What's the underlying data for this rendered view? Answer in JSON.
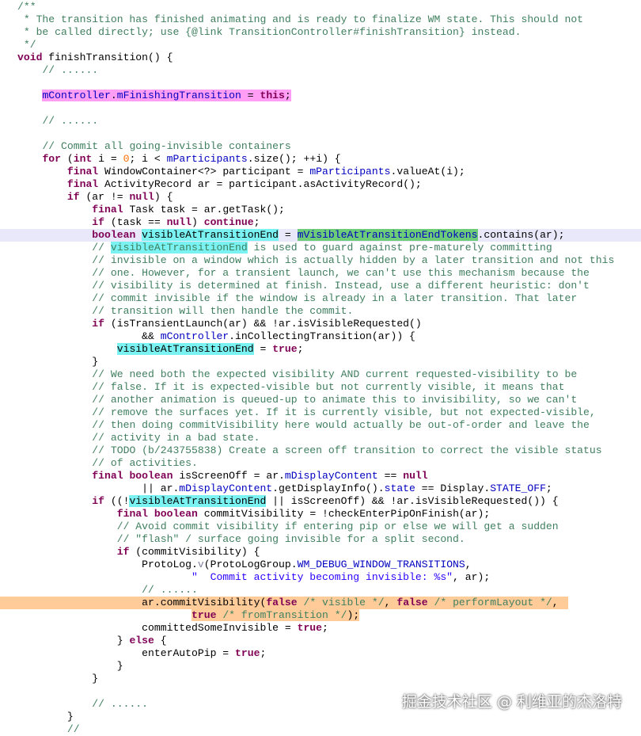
{
  "colors": {
    "background": "#ffffff",
    "comment": "#3f7f5f",
    "keyword": "#7f0055",
    "field": "#0000c0",
    "string": "#2a00ff",
    "number": "#ff6e00",
    "highlight_pink": "#ff9ef4",
    "highlight_cyan": "#7af2f2",
    "highlight_green": "#6ccc78",
    "highlight_orange": "#ffcc99",
    "current_line": "#e8e8fa"
  },
  "code_lines": [
    {
      "segs": [
        [
          "c",
          "/**"
        ]
      ]
    },
    {
      "segs": [
        [
          "c",
          " * The transition has finished animating and is ready to finalize WM state. This should not"
        ]
      ]
    },
    {
      "segs": [
        [
          "c",
          " * be called directly; use {@link TransitionController#finishTransition} instead."
        ]
      ]
    },
    {
      "segs": [
        [
          "c",
          " */"
        ]
      ]
    },
    {
      "segs": [
        [
          "k",
          "void"
        ],
        [
          "p",
          " finishTransition() {"
        ]
      ]
    },
    {
      "segs": [
        [
          "p",
          "    "
        ],
        [
          "c",
          "// ......"
        ]
      ]
    },
    {
      "segs": []
    },
    {
      "segs": [
        [
          "p",
          "    "
        ],
        [
          "f",
          "mController",
          "pink"
        ],
        [
          "p",
          ".",
          "pink"
        ],
        [
          "f",
          "mFinishingTransition",
          "pink"
        ],
        [
          "p",
          " = ",
          "pink"
        ],
        [
          "k",
          "this",
          "pink"
        ],
        [
          "p",
          ";",
          "pink"
        ]
      ]
    },
    {
      "segs": []
    },
    {
      "segs": [
        [
          "p",
          "    "
        ],
        [
          "c",
          "// ......"
        ]
      ]
    },
    {
      "segs": []
    },
    {
      "segs": [
        [
          "p",
          "    "
        ],
        [
          "c",
          "// Commit all going-invisible containers"
        ]
      ]
    },
    {
      "segs": [
        [
          "p",
          "    "
        ],
        [
          "k",
          "for"
        ],
        [
          "p",
          " ("
        ],
        [
          "k",
          "int"
        ],
        [
          "p",
          " i = "
        ],
        [
          "n",
          "0"
        ],
        [
          "p",
          "; i < "
        ],
        [
          "f",
          "mParticipants"
        ],
        [
          "p",
          ".size(); ++i) {"
        ]
      ]
    },
    {
      "segs": [
        [
          "p",
          "        "
        ],
        [
          "k",
          "final"
        ],
        [
          "p",
          " WindowContainer<?> participant = "
        ],
        [
          "f",
          "mParticipants"
        ],
        [
          "p",
          ".valueAt(i);"
        ]
      ]
    },
    {
      "segs": [
        [
          "p",
          "        "
        ],
        [
          "k",
          "final"
        ],
        [
          "p",
          " ActivityRecord ar = participant.asActivityRecord();"
        ]
      ]
    },
    {
      "segs": [
        [
          "p",
          "        "
        ],
        [
          "k",
          "if"
        ],
        [
          "p",
          " (ar != "
        ],
        [
          "k",
          "null"
        ],
        [
          "p",
          ") {"
        ]
      ]
    },
    {
      "segs": [
        [
          "p",
          "            "
        ],
        [
          "k",
          "final"
        ],
        [
          "p",
          " Task task = ar.getTask();"
        ]
      ]
    },
    {
      "segs": [
        [
          "p",
          "            "
        ],
        [
          "k",
          "if"
        ],
        [
          "p",
          " (task == "
        ],
        [
          "k",
          "null"
        ],
        [
          "p",
          ") "
        ],
        [
          "k",
          "continue"
        ],
        [
          "p",
          ";"
        ]
      ]
    },
    {
      "cur": true,
      "segs": [
        [
          "p",
          "            "
        ],
        [
          "k",
          "boolean"
        ],
        [
          "p",
          " "
        ],
        [
          "p",
          "visibleAtTransitionEnd",
          "cyan"
        ],
        [
          "p",
          " = "
        ],
        [
          "f",
          "mVisibleAtTransitionEndTokens",
          "green"
        ],
        [
          "p",
          ".contains(ar);"
        ]
      ]
    },
    {
      "segs": [
        [
          "p",
          "            "
        ],
        [
          "c",
          "// "
        ],
        [
          "c",
          "visibleAtTransitionEnd",
          "cyan"
        ],
        [
          "c",
          " is used to guard against pre-maturely committing"
        ]
      ]
    },
    {
      "segs": [
        [
          "p",
          "            "
        ],
        [
          "c",
          "// invisible on a window which is actually hidden by a later transition and not this"
        ]
      ]
    },
    {
      "segs": [
        [
          "p",
          "            "
        ],
        [
          "c",
          "// one. However, for a transient launch, we can't use this mechanism because the"
        ]
      ]
    },
    {
      "segs": [
        [
          "p",
          "            "
        ],
        [
          "c",
          "// visibility is determined at finish. Instead, use a different heuristic: don't"
        ]
      ]
    },
    {
      "segs": [
        [
          "p",
          "            "
        ],
        [
          "c",
          "// commit invisible if the window is already in a later transition. That later"
        ]
      ]
    },
    {
      "segs": [
        [
          "p",
          "            "
        ],
        [
          "c",
          "// transition will then handle the commit."
        ]
      ]
    },
    {
      "segs": [
        [
          "p",
          "            "
        ],
        [
          "k",
          "if"
        ],
        [
          "p",
          " (isTransientLaunch(ar) && !ar.isVisibleRequested()"
        ]
      ]
    },
    {
      "segs": [
        [
          "p",
          "                    && "
        ],
        [
          "f",
          "mController"
        ],
        [
          "p",
          ".inCollectingTransition(ar)) {"
        ]
      ]
    },
    {
      "segs": [
        [
          "p",
          "                "
        ],
        [
          "p",
          "visibleAtTransitionEnd",
          "cyan"
        ],
        [
          "p",
          " = "
        ],
        [
          "k",
          "true"
        ],
        [
          "p",
          ";"
        ]
      ]
    },
    {
      "segs": [
        [
          "p",
          "            }"
        ]
      ]
    },
    {
      "segs": [
        [
          "p",
          "            "
        ],
        [
          "c",
          "// We need both the expected visibility AND current requested-visibility to be"
        ]
      ]
    },
    {
      "segs": [
        [
          "p",
          "            "
        ],
        [
          "c",
          "// false. If it is expected-visible but not currently visible, it means that"
        ]
      ]
    },
    {
      "segs": [
        [
          "p",
          "            "
        ],
        [
          "c",
          "// another animation is queued-up to animate this to invisibility, so we can't"
        ]
      ]
    },
    {
      "segs": [
        [
          "p",
          "            "
        ],
        [
          "c",
          "// remove the surfaces yet. If it is currently visible, but not expected-visible,"
        ]
      ]
    },
    {
      "segs": [
        [
          "p",
          "            "
        ],
        [
          "c",
          "// then doing commitVisibility here would actually be out-of-order and leave the"
        ]
      ]
    },
    {
      "segs": [
        [
          "p",
          "            "
        ],
        [
          "c",
          "// activity in a bad state."
        ]
      ]
    },
    {
      "segs": [
        [
          "p",
          "            "
        ],
        [
          "c",
          "// TODO (b/243755838) Create a screen off transition to correct the visible status"
        ]
      ]
    },
    {
      "segs": [
        [
          "p",
          "            "
        ],
        [
          "c",
          "// of activities."
        ]
      ]
    },
    {
      "segs": [
        [
          "p",
          "            "
        ],
        [
          "k",
          "final"
        ],
        [
          "p",
          " "
        ],
        [
          "k",
          "boolean"
        ],
        [
          "p",
          " isScreenOff = ar."
        ],
        [
          "f",
          "mDisplayContent"
        ],
        [
          "p",
          " == "
        ],
        [
          "k",
          "null"
        ]
      ]
    },
    {
      "segs": [
        [
          "p",
          "                    || ar."
        ],
        [
          "f",
          "mDisplayContent"
        ],
        [
          "p",
          ".getDisplayInfo()."
        ],
        [
          "f",
          "state"
        ],
        [
          "p",
          " == Display."
        ],
        [
          "f",
          "STATE_OFF"
        ],
        [
          "p",
          ";"
        ]
      ]
    },
    {
      "segs": [
        [
          "p",
          "            "
        ],
        [
          "k",
          "if"
        ],
        [
          "p",
          " ((!"
        ],
        [
          "p",
          "visibleAtTransitionEnd",
          "cyan"
        ],
        [
          "p",
          " || isScreenOff) && !ar.isVisibleRequested()) {"
        ]
      ]
    },
    {
      "segs": [
        [
          "p",
          "                "
        ],
        [
          "k",
          "final"
        ],
        [
          "p",
          " "
        ],
        [
          "k",
          "boolean"
        ],
        [
          "p",
          " commitVisibility = !checkEnterPipOnFinish(ar);"
        ]
      ]
    },
    {
      "segs": [
        [
          "p",
          "                "
        ],
        [
          "c",
          "// Avoid commit visibility if entering pip or else we will get a sudden"
        ]
      ]
    },
    {
      "segs": [
        [
          "p",
          "                "
        ],
        [
          "c",
          "// \"flash\" / surface going invisible for a split second."
        ]
      ]
    },
    {
      "segs": [
        [
          "p",
          "                "
        ],
        [
          "k",
          "if"
        ],
        [
          "p",
          " (commitVisibility) {"
        ]
      ]
    },
    {
      "segs": [
        [
          "p",
          "                    ProtoLog."
        ],
        [
          "i",
          "v"
        ],
        [
          "p",
          "(ProtoLogGroup."
        ],
        [
          "f",
          "WM_DEBUG_WINDOW_TRANSITIONS"
        ],
        [
          "p",
          ","
        ]
      ]
    },
    {
      "segs": [
        [
          "p",
          "                            "
        ],
        [
          "s",
          "\"  Commit activity becoming invisible: %s\""
        ],
        [
          "p",
          ", ar);"
        ]
      ]
    },
    {
      "segs": [
        [
          "p",
          "                    "
        ],
        [
          "c",
          "// ......"
        ]
      ]
    },
    {
      "orange": true,
      "segs": [
        [
          "p",
          "                    ar.commitVisibility("
        ],
        [
          "k",
          "false"
        ],
        [
          "p",
          " "
        ],
        [
          "c",
          "/* visible */"
        ],
        [
          "p",
          ", "
        ],
        [
          "k",
          "false"
        ],
        [
          "p",
          " "
        ],
        [
          "c",
          "/* performLayout */"
        ],
        [
          "p",
          ","
        ]
      ]
    },
    {
      "segs": [
        [
          "p",
          "                            "
        ],
        [
          "k",
          "true",
          "orange"
        ],
        [
          "p",
          " ",
          "orange"
        ],
        [
          "c",
          "/* fromTransition */",
          "orange"
        ],
        [
          "p",
          ");",
          "orange"
        ]
      ]
    },
    {
      "segs": [
        [
          "p",
          "                    committedSomeInvisible = "
        ],
        [
          "k",
          "true"
        ],
        [
          "p",
          ";"
        ]
      ]
    },
    {
      "segs": [
        [
          "p",
          "                } "
        ],
        [
          "k",
          "else"
        ],
        [
          "p",
          " {"
        ]
      ]
    },
    {
      "segs": [
        [
          "p",
          "                    enterAutoPip = "
        ],
        [
          "k",
          "true"
        ],
        [
          "p",
          ";"
        ]
      ]
    },
    {
      "segs": [
        [
          "p",
          "                }"
        ]
      ]
    },
    {
      "segs": [
        [
          "p",
          "            }"
        ]
      ]
    },
    {
      "segs": []
    },
    {
      "segs": [
        [
          "p",
          "            "
        ],
        [
          "c",
          "// ......"
        ]
      ]
    },
    {
      "segs": [
        [
          "p",
          "        }"
        ]
      ]
    },
    {
      "segs": [
        [
          "p",
          "        "
        ],
        [
          "c",
          "//"
        ]
      ]
    }
  ],
  "watermark": "掘金技术社区 @ 利维亚的杰洛特"
}
